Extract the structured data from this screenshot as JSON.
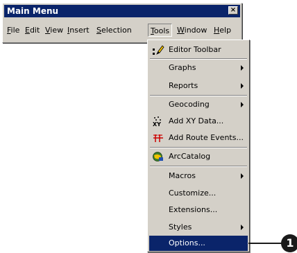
{
  "window": {
    "title": "Main Menu",
    "close_glyph": "×"
  },
  "menubar": {
    "items": [
      {
        "label": "File",
        "active": false
      },
      {
        "label": "Edit",
        "active": false
      },
      {
        "label": "View",
        "active": false
      },
      {
        "label": "Insert",
        "active": false
      },
      {
        "label": "Selection",
        "active": false
      },
      {
        "label": "Tools",
        "active": true
      },
      {
        "label": "Window",
        "active": false
      },
      {
        "label": "Help",
        "active": false
      }
    ]
  },
  "tools_menu": {
    "items": [
      {
        "label": "Editor Toolbar",
        "icon": "editor-pencil-icon",
        "submenu": false
      },
      {
        "label": "Graphs",
        "icon": null,
        "submenu": true
      },
      {
        "label": "Reports",
        "icon": null,
        "submenu": true
      },
      {
        "label": "Geocoding",
        "icon": null,
        "submenu": true
      },
      {
        "label": "Add XY Data...",
        "icon": "xy-data-icon",
        "submenu": false
      },
      {
        "label": "Add Route Events...",
        "icon": "route-events-icon",
        "submenu": false
      },
      {
        "label": "ArcCatalog",
        "icon": "arccatalog-icon",
        "submenu": false
      },
      {
        "label": "Macros",
        "icon": null,
        "submenu": true
      },
      {
        "label": "Customize...",
        "icon": null,
        "submenu": false
      },
      {
        "label": "Extensions...",
        "icon": null,
        "submenu": false
      },
      {
        "label": "Styles",
        "icon": null,
        "submenu": true
      },
      {
        "label": "Options...",
        "icon": null,
        "submenu": false,
        "highlighted": true
      }
    ]
  },
  "callout": {
    "number": "1"
  },
  "colors": {
    "title_bar": "#0a246a",
    "face": "#d4d0c8",
    "highlight": "#0a246a"
  }
}
